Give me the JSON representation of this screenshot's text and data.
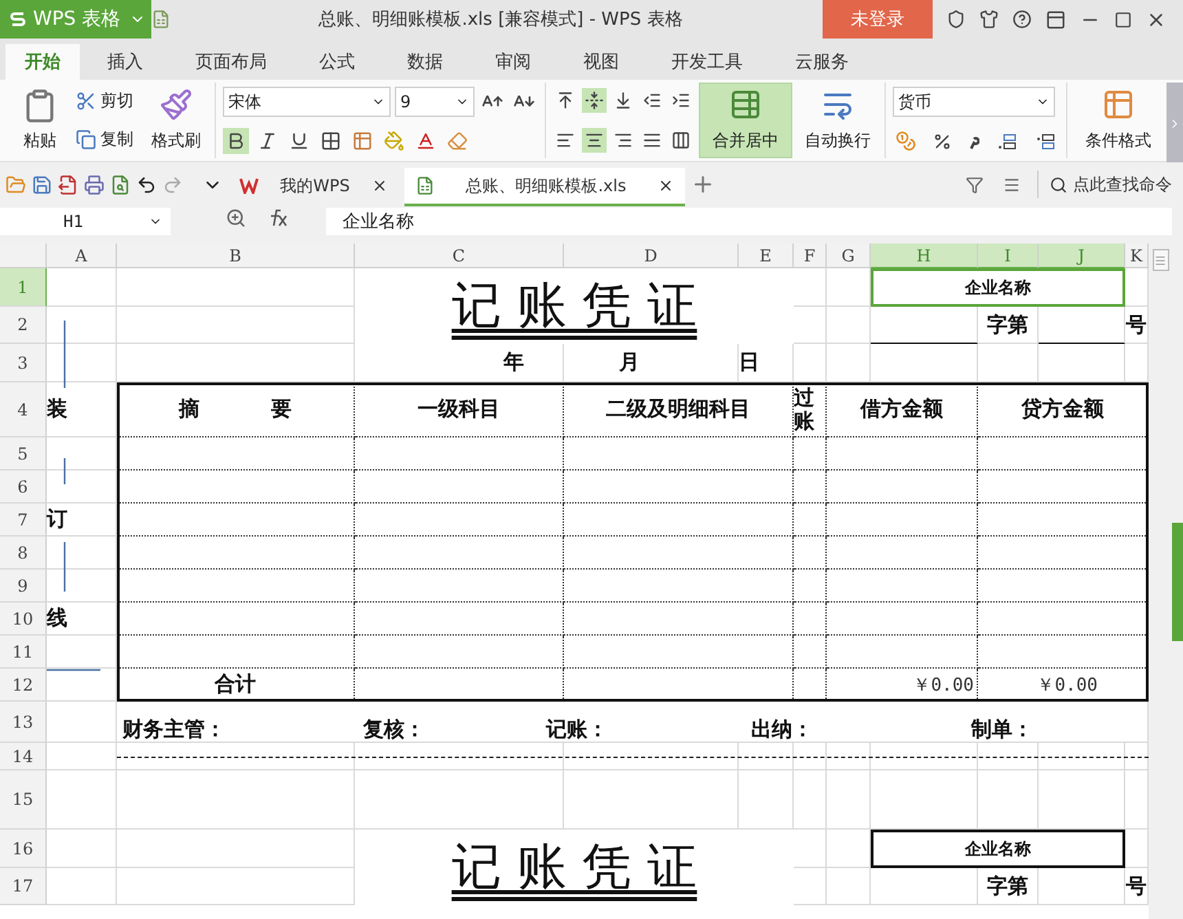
{
  "app_menu": {
    "label": "WPS 表格"
  },
  "window": {
    "title": "总账、明细账模板.xls [兼容模式] - WPS 表格"
  },
  "login_button": {
    "label": "未登录"
  },
  "ribbon_tabs": [
    {
      "label": "开始",
      "selected": true
    },
    {
      "label": "插入",
      "selected": false
    },
    {
      "label": "页面布局",
      "selected": false
    },
    {
      "label": "公式",
      "selected": false
    },
    {
      "label": "数据",
      "selected": false
    },
    {
      "label": "审阅",
      "selected": false
    },
    {
      "label": "视图",
      "selected": false
    },
    {
      "label": "开发工具",
      "selected": false
    },
    {
      "label": "云服务",
      "selected": false
    }
  ],
  "clipboard": {
    "paste": "粘贴",
    "cut": "剪切",
    "copy": "复制",
    "format_painter": "格式刷"
  },
  "font": {
    "name": "宋体",
    "size": "9",
    "bold": true,
    "italic": false,
    "underline": false
  },
  "alignment": {
    "align_top": false,
    "align_middle": true,
    "align_bottom": false,
    "align_left": false,
    "align_center": true,
    "align_right": false,
    "justify": false
  },
  "merge_center": {
    "label": "合并居中",
    "selected": true
  },
  "wrap_text": {
    "label": "自动换行",
    "selected": false
  },
  "number_format": {
    "value": "货币"
  },
  "conditional_format": {
    "label": "条件格式"
  },
  "doc_tabs": [
    {
      "label": "我的WPS",
      "selected": false
    },
    {
      "label": "总账、明细账模板.xls",
      "selected": true
    }
  ],
  "command_search": {
    "placeholder": "点此查找命令"
  },
  "name_box": {
    "value": "H1"
  },
  "formula_bar": {
    "value": "企业名称"
  },
  "columns": [
    {
      "label": "A",
      "selected": false
    },
    {
      "label": "B",
      "selected": false
    },
    {
      "label": "C",
      "selected": false
    },
    {
      "label": "D",
      "selected": false
    },
    {
      "label": "E",
      "selected": false
    },
    {
      "label": "F",
      "selected": false
    },
    {
      "label": "G",
      "selected": false
    },
    {
      "label": "H",
      "selected": true
    },
    {
      "label": "I",
      "selected": true
    },
    {
      "label": "J",
      "selected": true
    },
    {
      "label": "K",
      "selected": false
    }
  ],
  "rows": [
    {
      "label": "1",
      "selected": true
    },
    {
      "label": "2",
      "selected": false
    },
    {
      "label": "3",
      "selected": false
    },
    {
      "label": "4",
      "selected": false
    },
    {
      "label": "5",
      "selected": false
    },
    {
      "label": "6",
      "selected": false
    },
    {
      "label": "7",
      "selected": false
    },
    {
      "label": "8",
      "selected": false
    },
    {
      "label": "9",
      "selected": false
    },
    {
      "label": "10",
      "selected": false
    },
    {
      "label": "11",
      "selected": false
    },
    {
      "label": "12",
      "selected": false
    },
    {
      "label": "13",
      "selected": false
    },
    {
      "label": "14",
      "selected": false
    },
    {
      "label": "15",
      "selected": false
    },
    {
      "label": "16",
      "selected": false
    },
    {
      "label": "17",
      "selected": false
    }
  ],
  "cells": [
    {
      "text": "记 账 凭 证",
      "kind": "title",
      "selected": false
    },
    {
      "text": "企业名称",
      "kind": "small",
      "selected": true
    },
    {
      "text": "字第",
      "kind": "label",
      "selected": false
    },
    {
      "text": "号",
      "kind": "label",
      "selected": false
    },
    {
      "text": "年",
      "kind": "label",
      "selected": false
    },
    {
      "text": "月",
      "kind": "label",
      "selected": false
    },
    {
      "text": "日",
      "kind": "label",
      "selected": false
    },
    {
      "text": "装",
      "kind": "label",
      "selected": false
    },
    {
      "text": "订",
      "kind": "label",
      "selected": false
    },
    {
      "text": "线",
      "kind": "label",
      "selected": false
    },
    {
      "text": "摘          要",
      "kind": "header",
      "selected": false
    },
    {
      "text": "一级科目",
      "kind": "header",
      "selected": false
    },
    {
      "text": "二级及明细科目",
      "kind": "header",
      "selected": false
    },
    {
      "text": "过账",
      "kind": "header",
      "selected": false
    },
    {
      "text": "借方金额",
      "kind": "header",
      "selected": false
    },
    {
      "text": "贷方金额",
      "kind": "header",
      "selected": false
    },
    {
      "text": "合计",
      "kind": "header",
      "selected": false
    },
    {
      "text": "￥0.00",
      "kind": "amount",
      "selected": false
    },
    {
      "text": "￥0.00",
      "kind": "amount",
      "selected": false
    },
    {
      "text": "财务主管：",
      "kind": "sign",
      "selected": false
    },
    {
      "text": "复核：",
      "kind": "sign",
      "selected": false
    },
    {
      "text": "记账：",
      "kind": "sign",
      "selected": false
    },
    {
      "text": "出纳：",
      "kind": "sign",
      "selected": false
    },
    {
      "text": "制单：",
      "kind": "sign",
      "selected": false
    },
    {
      "text": "记 账 凭 证",
      "kind": "title",
      "selected": false
    },
    {
      "text": "企业名称",
      "kind": "small",
      "selected": false
    },
    {
      "text": "字第",
      "kind": "label",
      "selected": false
    },
    {
      "text": "号",
      "kind": "label",
      "selected": false
    }
  ]
}
